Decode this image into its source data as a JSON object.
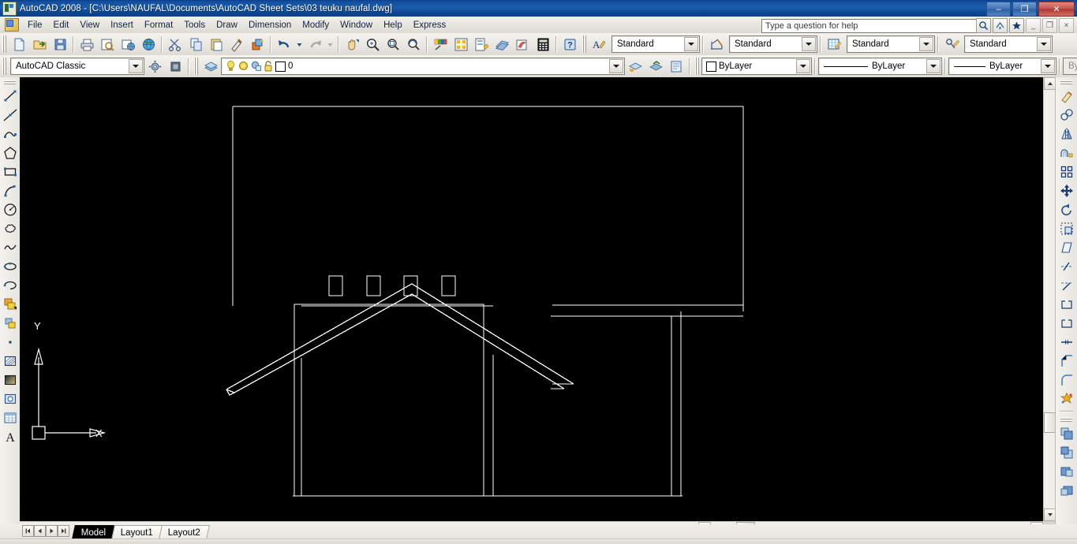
{
  "window": {
    "title": "AutoCAD 2008 - [C:\\Users\\NAUFAL\\Documents\\AutoCAD Sheet Sets\\03 teuku naufal.dwg]",
    "app_icon": "autocad-icon",
    "minimize_label": "–",
    "restore_label": "❐",
    "close_label": "✕"
  },
  "menu": {
    "items": [
      {
        "label": "File"
      },
      {
        "label": "Edit"
      },
      {
        "label": "View"
      },
      {
        "label": "Insert"
      },
      {
        "label": "Format"
      },
      {
        "label": "Tools"
      },
      {
        "label": "Draw"
      },
      {
        "label": "Dimension"
      },
      {
        "label": "Modify"
      },
      {
        "label": "Window"
      },
      {
        "label": "Help"
      },
      {
        "label": "Express"
      }
    ],
    "help_search_placeholder": "Type a question for help",
    "doc_minimize_label": "_",
    "doc_restore_label": "❐",
    "doc_close_label": "×"
  },
  "standard_toolbar": {
    "buttons": [
      {
        "name": "new-icon",
        "tip": "QNew"
      },
      {
        "name": "open-icon",
        "tip": "Open"
      },
      {
        "name": "save-icon",
        "tip": "Save"
      },
      {
        "name": "plot-icon",
        "tip": "Plot"
      },
      {
        "name": "plot-preview-icon",
        "tip": "Plot Preview"
      },
      {
        "name": "publish-icon",
        "tip": "Publish"
      },
      {
        "name": "3dprint-icon",
        "tip": "Publish to Web"
      },
      {
        "name": "cut-icon",
        "tip": "Cut"
      },
      {
        "name": "copy-icon",
        "tip": "Copy"
      },
      {
        "name": "paste-icon",
        "tip": "Paste"
      },
      {
        "name": "match-properties-icon",
        "tip": "Match Properties"
      },
      {
        "name": "block-editor-icon",
        "tip": "Block Editor"
      },
      {
        "name": "undo-icon",
        "tip": "Undo"
      },
      {
        "name": "redo-icon",
        "tip": "Redo"
      },
      {
        "name": "pan-icon",
        "tip": "Pan Realtime"
      },
      {
        "name": "zoom-realtime-icon",
        "tip": "Zoom Realtime"
      },
      {
        "name": "zoom-window-icon",
        "tip": "Zoom Window"
      },
      {
        "name": "zoom-previous-icon",
        "tip": "Zoom Previous"
      },
      {
        "name": "properties-icon",
        "tip": "Properties"
      },
      {
        "name": "design-center-icon",
        "tip": "DesignCenter"
      },
      {
        "name": "tool-palettes-icon",
        "tip": "Tool Palettes"
      },
      {
        "name": "sheet-set-manager-icon",
        "tip": "Sheet Set Manager"
      },
      {
        "name": "markup-set-manager-icon",
        "tip": "Markup Set Manager"
      },
      {
        "name": "quickcalc-icon",
        "tip": "QuickCalc"
      },
      {
        "name": "help-icon",
        "tip": "Help"
      }
    ]
  },
  "styles_toolbar": {
    "text_style": {
      "icon": "text-style-icon",
      "value": "Standard"
    },
    "dimension_style": {
      "icon": "dimension-style-icon",
      "value": "Standard"
    },
    "table_style": {
      "icon": "table-style-icon",
      "value": "Standard"
    },
    "multileader_style": {
      "icon": "multileader-style-icon",
      "value": "Standard"
    }
  },
  "workspaces_toolbar": {
    "workspace": "AutoCAD Classic",
    "settings_icon": "workspace-settings-icon",
    "lock_icon": "toolbar-lock-icon"
  },
  "layers_toolbar": {
    "layer_properties_icon": "layer-properties-manager-icon",
    "current_layer": "0",
    "state_icons": [
      "lightbulb-on-icon",
      "freeze-sun-icon",
      "freeze-viewport-icon",
      "unlocked-padlock-icon"
    ],
    "color_swatch": "#ffffff",
    "extra_icons": [
      "layer-previous-icon",
      "make-object-layer-current-icon",
      "layer-states-icon"
    ]
  },
  "properties_toolbar": {
    "color": "ByLayer",
    "linetype": "ByLayer",
    "lineweight": "ByLayer",
    "plot_style": "ByColor"
  },
  "draw_toolbar": {
    "buttons": [
      {
        "name": "line-icon"
      },
      {
        "name": "construction-line-icon"
      },
      {
        "name": "polyline-icon"
      },
      {
        "name": "polygon-icon"
      },
      {
        "name": "rectangle-icon"
      },
      {
        "name": "arc-icon"
      },
      {
        "name": "circle-icon"
      },
      {
        "name": "revision-cloud-icon"
      },
      {
        "name": "spline-icon"
      },
      {
        "name": "ellipse-icon"
      },
      {
        "name": "ellipse-arc-icon"
      },
      {
        "name": "insert-block-icon"
      },
      {
        "name": "make-block-icon"
      },
      {
        "name": "point-icon"
      },
      {
        "name": "hatch-icon"
      },
      {
        "name": "gradient-icon"
      },
      {
        "name": "region-icon"
      },
      {
        "name": "table-icon"
      },
      {
        "name": "multiline-text-icon"
      }
    ]
  },
  "modify_toolbar": {
    "buttons": [
      {
        "name": "erase-icon"
      },
      {
        "name": "copy-object-icon"
      },
      {
        "name": "mirror-icon"
      },
      {
        "name": "offset-icon"
      },
      {
        "name": "array-icon"
      },
      {
        "name": "move-icon"
      },
      {
        "name": "rotate-icon"
      },
      {
        "name": "scale-icon"
      },
      {
        "name": "stretch-icon"
      },
      {
        "name": "trim-icon"
      },
      {
        "name": "extend-icon"
      },
      {
        "name": "break-at-point-icon"
      },
      {
        "name": "break-icon"
      },
      {
        "name": "join-icon"
      },
      {
        "name": "chamfer-icon"
      },
      {
        "name": "fillet-icon"
      },
      {
        "name": "explode-icon"
      }
    ],
    "draworder_buttons": [
      {
        "name": "bring-to-front-icon"
      },
      {
        "name": "send-to-back-icon"
      },
      {
        "name": "bring-above-object-icon"
      },
      {
        "name": "send-under-object-icon"
      }
    ]
  },
  "drawing": {
    "background": "#000000",
    "line_color": "#ffffff",
    "description": "Building front elevation: gable roof over wall with four small windows, large door opening, and flat canopy roof to the right supported by a column.",
    "ucs_icon": {
      "x_label": "X",
      "y_label": "Y",
      "name": "ucs-icon"
    }
  },
  "scrollbars": {
    "vertical": {
      "up_arrow": "scroll-up-arrow",
      "down_arrow": "scroll-down-arrow"
    },
    "horizontal": {
      "left_arrow": "scroll-left-arrow",
      "right_arrow": "scroll-right-arrow"
    }
  },
  "layout_tabs": {
    "nav_first": "◀|",
    "nav_prev": "◀",
    "nav_next": "▶",
    "nav_last": "|▶",
    "tabs": [
      {
        "label": "Model",
        "active": true
      },
      {
        "label": "Layout1",
        "active": false
      },
      {
        "label": "Layout2",
        "active": false
      }
    ]
  }
}
